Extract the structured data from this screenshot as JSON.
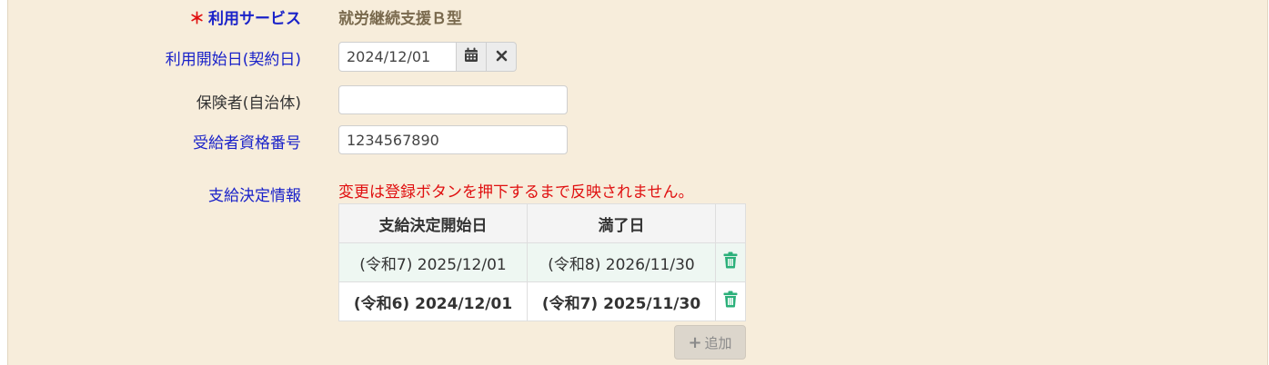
{
  "form": {
    "service": {
      "required_mark": "＊",
      "label": "利用サービス",
      "value": "就労継続支援Ｂ型"
    },
    "start_date": {
      "label": "利用開始日(契約日)",
      "value": "2024/12/01"
    },
    "insurer": {
      "label": "保険者(自治体)",
      "value": ""
    },
    "recipient_number": {
      "label": "受給者資格番号",
      "value": "1234567890"
    },
    "payment_decision": {
      "label": "支給決定情報",
      "notice": "変更は登録ボタンを押下するまで反映されません。",
      "columns": [
        "支給決定開始日",
        "満了日"
      ],
      "rows": [
        {
          "start": "(令和7) 2025/12/01",
          "end": "(令和8) 2026/11/30"
        },
        {
          "start": "(令和6) 2024/12/01",
          "end": "(令和7) 2025/11/30"
        }
      ],
      "add_label": "追加"
    }
  },
  "icons": {
    "calendar": "calendar-icon",
    "clear": "close-icon",
    "delete": "trash-icon",
    "add": "plus-icon"
  },
  "colors": {
    "background": "#f7eddb",
    "label_blue": "#1a22c9",
    "required": "#e01010",
    "notice": "#e01010",
    "trash": "#2bb07a"
  }
}
